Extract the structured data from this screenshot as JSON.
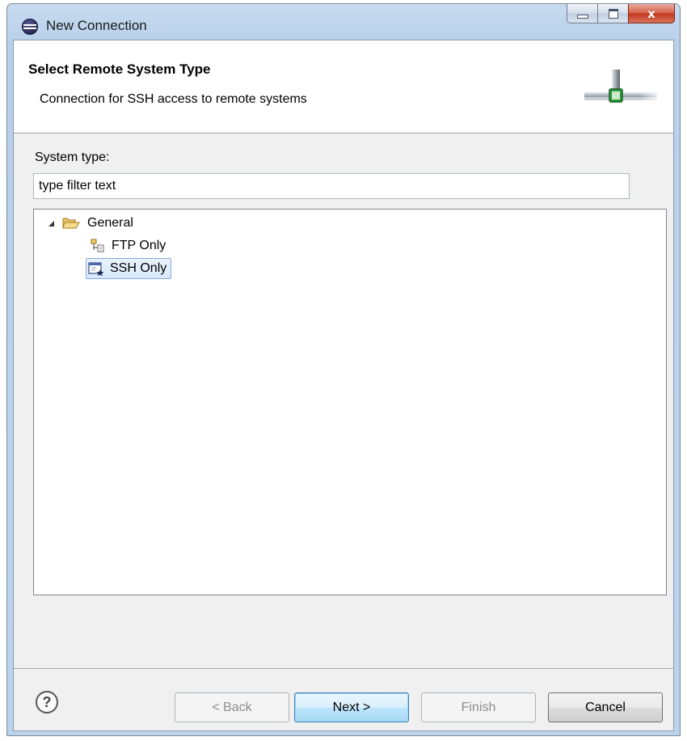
{
  "window": {
    "title": "New Connection",
    "app_icon": "eclipse-icon",
    "controls": [
      "minimize-icon",
      "maximize-icon",
      "close-icon"
    ]
  },
  "banner": {
    "title": "Select Remote System Type",
    "description": "Connection for SSH access to remote systems",
    "graphic": "connection-wizard-icon"
  },
  "form": {
    "system_type_label": "System type:",
    "filter": {
      "value": "type filter text",
      "placeholder": "type filter text"
    }
  },
  "tree": {
    "root": {
      "label": "General",
      "icon": "folder-open-icon",
      "expanded": true
    },
    "children": [
      {
        "label": "FTP Only",
        "icon": "ftp-connection-icon",
        "selected": false
      },
      {
        "label": "SSH Only",
        "icon": "ssh-connection-icon",
        "selected": true
      }
    ]
  },
  "buttons": {
    "help_icon": "help-icon",
    "back": "< Back",
    "next": "Next >",
    "finish": "Finish",
    "cancel": "Cancel"
  },
  "colors": {
    "window_frame": "#b9d0ea",
    "selection_border": "#84acdd",
    "default_button": "#bee6fd"
  }
}
